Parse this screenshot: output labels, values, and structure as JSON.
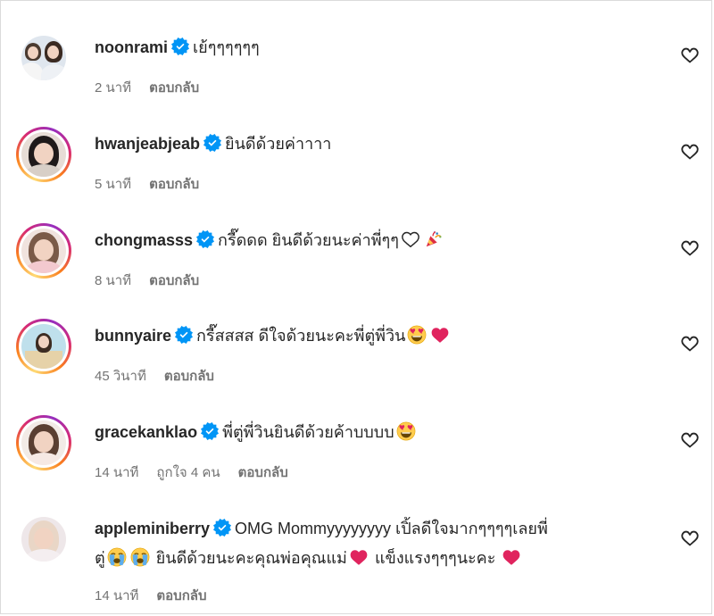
{
  "colors": {
    "text": "#262626",
    "meta": "#737373",
    "verified": "#0095f6",
    "heart": "#e0245e"
  },
  "comments": [
    {
      "username": "noonrami",
      "verified": true,
      "story_ring": false,
      "text": "เย้ๆๆๆๆๆๆ",
      "time": "2 นาที",
      "likes": "",
      "reply": "ตอบกลับ"
    },
    {
      "username": "hwanjeabjeab",
      "verified": true,
      "story_ring": true,
      "text": "ยินดีด้วยค่าาาา",
      "time": "5 นาที",
      "likes": "",
      "reply": "ตอบกลับ"
    },
    {
      "username": "chongmasss",
      "verified": true,
      "story_ring": true,
      "text": "กรี๊ดดด ยินดีด้วยนะค่าพี่ๆๆ",
      "emojis": [
        "white-heart-icon",
        "party-popper-icon"
      ],
      "time": "8 นาที",
      "likes": "",
      "reply": "ตอบกลับ"
    },
    {
      "username": "bunnyaire",
      "verified": true,
      "story_ring": true,
      "text": "กรี๊สสสส ดีใจด้วยนะคะพี่ตู่พี่วิน",
      "emojis": [
        "heart-eyes-icon",
        "red-heart-icon"
      ],
      "time": "45 วินาที",
      "likes": "",
      "reply": "ตอบกลับ"
    },
    {
      "username": "gracekanklao",
      "verified": true,
      "story_ring": true,
      "text": "พี่ตู่พี่วินยินดีด้วยค้าบบบบ",
      "emojis": [
        "heart-eyes-icon"
      ],
      "time": "14 นาที",
      "likes": "ถูกใจ 4 คน",
      "reply": "ตอบกลับ"
    },
    {
      "username": "appleminiberry",
      "verified": true,
      "story_ring": false,
      "text_line1": "OMG Mommyyyyyyyy เปิ้ลดีใจมากๆๆๆๆเลยพี่",
      "text_line2_a": "ตู่",
      "text_line2_b": "ยินดีด้วยนะคะคุณพ่อคุณแม่",
      "text_line2_c": "แข็งแรงๆๆๆนะคะ",
      "time": "14 นาที",
      "likes": "",
      "reply": "ตอบกลับ"
    }
  ]
}
